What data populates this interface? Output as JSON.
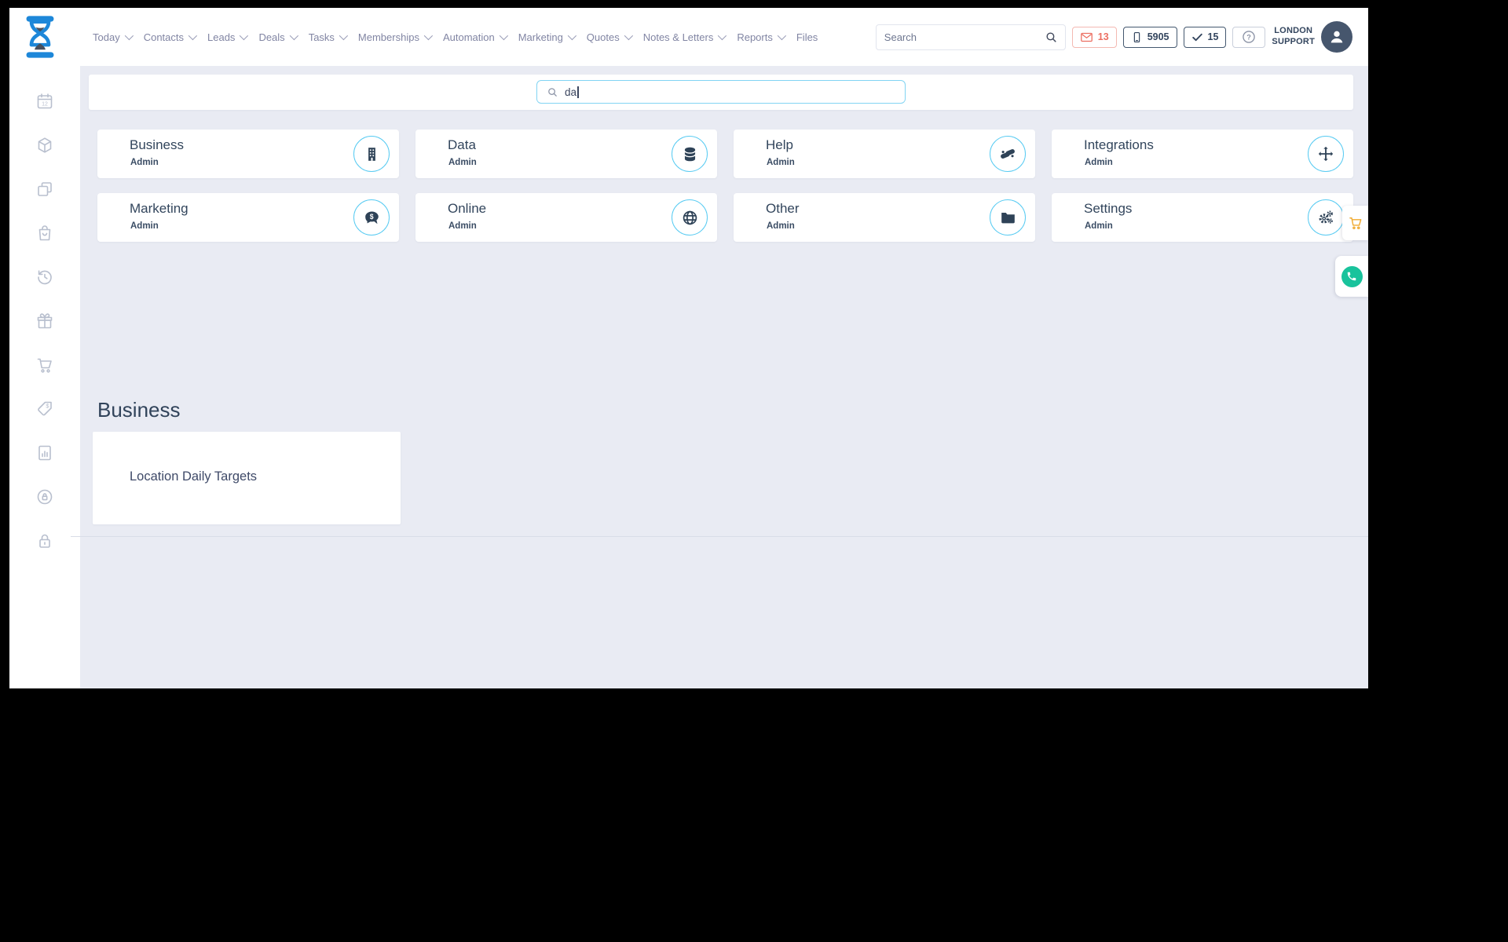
{
  "header": {
    "nav": [
      {
        "label": "Today",
        "caret": true
      },
      {
        "label": "Contacts",
        "caret": true
      },
      {
        "label": "Leads",
        "caret": true
      },
      {
        "label": "Deals",
        "caret": true
      },
      {
        "label": "Tasks",
        "caret": true
      },
      {
        "label": "Memberships",
        "caret": true
      },
      {
        "label": "Automation",
        "caret": true
      },
      {
        "label": "Marketing",
        "caret": true
      },
      {
        "label": "Quotes",
        "caret": true
      },
      {
        "label": "Notes & Letters",
        "caret": true
      },
      {
        "label": "Reports",
        "caret": true
      },
      {
        "label": "Files",
        "caret": false
      }
    ],
    "search_placeholder": "Search",
    "badges": {
      "mail_count": "13",
      "phone_count": "5905",
      "check_count": "15"
    },
    "account": {
      "line1": "LONDON",
      "line2": "SUPPORT"
    }
  },
  "sidebar": {
    "icons": [
      "calendar-icon",
      "package-icon",
      "copy-icon",
      "shopping-bag-icon",
      "history-icon",
      "gift-icon",
      "cart-icon",
      "price-tag-icon",
      "report-chart-icon",
      "security-icon",
      "lock-icon"
    ]
  },
  "main": {
    "module_search": {
      "value": "da",
      "icon": "search-icon"
    },
    "categories": [
      {
        "title": "Business",
        "subtitle": "Admin",
        "icon": "building-icon"
      },
      {
        "title": "Data",
        "subtitle": "Admin",
        "icon": "database-icon"
      },
      {
        "title": "Help",
        "subtitle": "Admin",
        "icon": "handshake-icon"
      },
      {
        "title": "Integrations",
        "subtitle": "Admin",
        "icon": "move-arrows-icon"
      },
      {
        "title": "Marketing",
        "subtitle": "Admin",
        "icon": "comment-dollar-icon"
      },
      {
        "title": "Online",
        "subtitle": "Admin",
        "icon": "globe-icon"
      },
      {
        "title": "Other",
        "subtitle": "Admin",
        "icon": "folder-icon"
      },
      {
        "title": "Settings",
        "subtitle": "Admin",
        "icon": "gears-icon"
      }
    ],
    "section": {
      "heading": "Business",
      "items": [
        {
          "label": "Location Daily Targets"
        }
      ]
    }
  },
  "floating": {
    "cart_icon": "cart-icon",
    "phone_icon": "phone-icon"
  },
  "colors": {
    "brand_blue": "#1d87d9",
    "circle_blue": "#58cbf2",
    "navy": "#32455c",
    "salmon": "#ec6f62",
    "orange": "#f0a92e",
    "green": "#19c39c",
    "nav_gray": "#8185a3",
    "sidebar_icon_gray": "#b8bfce",
    "background": "#e9ebf3"
  }
}
